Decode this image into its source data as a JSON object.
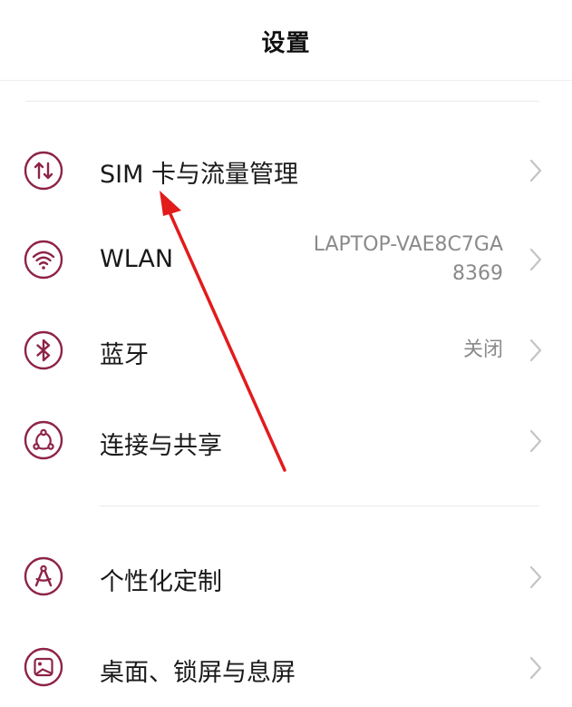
{
  "header": {
    "title": "设置"
  },
  "rows": [
    {
      "icon": "sim-data-icon",
      "label": "SIM 卡与流量管理",
      "value_line1": "",
      "value_line2": ""
    },
    {
      "icon": "wifi-icon",
      "label": "WLAN",
      "value_line1": "LAPTOP-VAE8C7GA",
      "value_line2": "8369"
    },
    {
      "icon": "bluetooth-icon",
      "label": "蓝牙",
      "value_line1": "关闭",
      "value_line2": ""
    },
    {
      "icon": "connection-share-icon",
      "label": "连接与共享",
      "value_line1": "",
      "value_line2": ""
    },
    {
      "icon": "personalization-icon",
      "label": "个性化定制",
      "value_line1": "",
      "value_line2": ""
    },
    {
      "icon": "wallpaper-icon",
      "label": "桌面、锁屏与息屏",
      "value_line1": "",
      "value_line2": ""
    }
  ],
  "colors": {
    "icon_accent": "#8e2345",
    "annotation_arrow": "#e21b1b",
    "chevron": "#c4c4c4",
    "secondary_text": "#8a8a8a"
  }
}
